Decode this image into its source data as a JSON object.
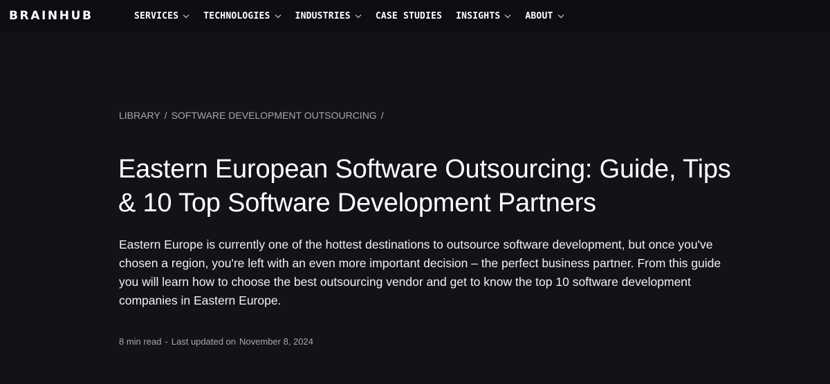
{
  "header": {
    "logo": "BRAINHUB",
    "nav": [
      {
        "label": "SERVICES",
        "has_dropdown": true
      },
      {
        "label": "TECHNOLOGIES",
        "has_dropdown": true
      },
      {
        "label": "INDUSTRIES",
        "has_dropdown": true
      },
      {
        "label": "CASE STUDIES",
        "has_dropdown": false
      },
      {
        "label": "INSIGHTS",
        "has_dropdown": true
      },
      {
        "label": "ABOUT",
        "has_dropdown": true
      }
    ]
  },
  "breadcrumb": {
    "items": [
      "LIBRARY",
      "SOFTWARE DEVELOPMENT OUTSOURCING"
    ],
    "separator": "/"
  },
  "article": {
    "title": "Eastern European Software Outsourcing: Guide, Tips & 10 Top Software Development Partners",
    "lead": "Eastern Europe is currently one of the hottest destinations to outsource software development, but once you've chosen a region, you're left with an even more important decision – the perfect business partner. From this guide you will learn how to choose the best outsourcing vendor and get to know the top 10 software development companies in Eastern Europe.",
    "read_time": "8 min read",
    "meta_dash": "-",
    "updated_label": "Last updated on",
    "updated_date": "November 8, 2024"
  },
  "colors": {
    "background": "#141217",
    "header_background": "#0f0d12",
    "text": "#ffffff",
    "muted": "#a9a7ad"
  }
}
